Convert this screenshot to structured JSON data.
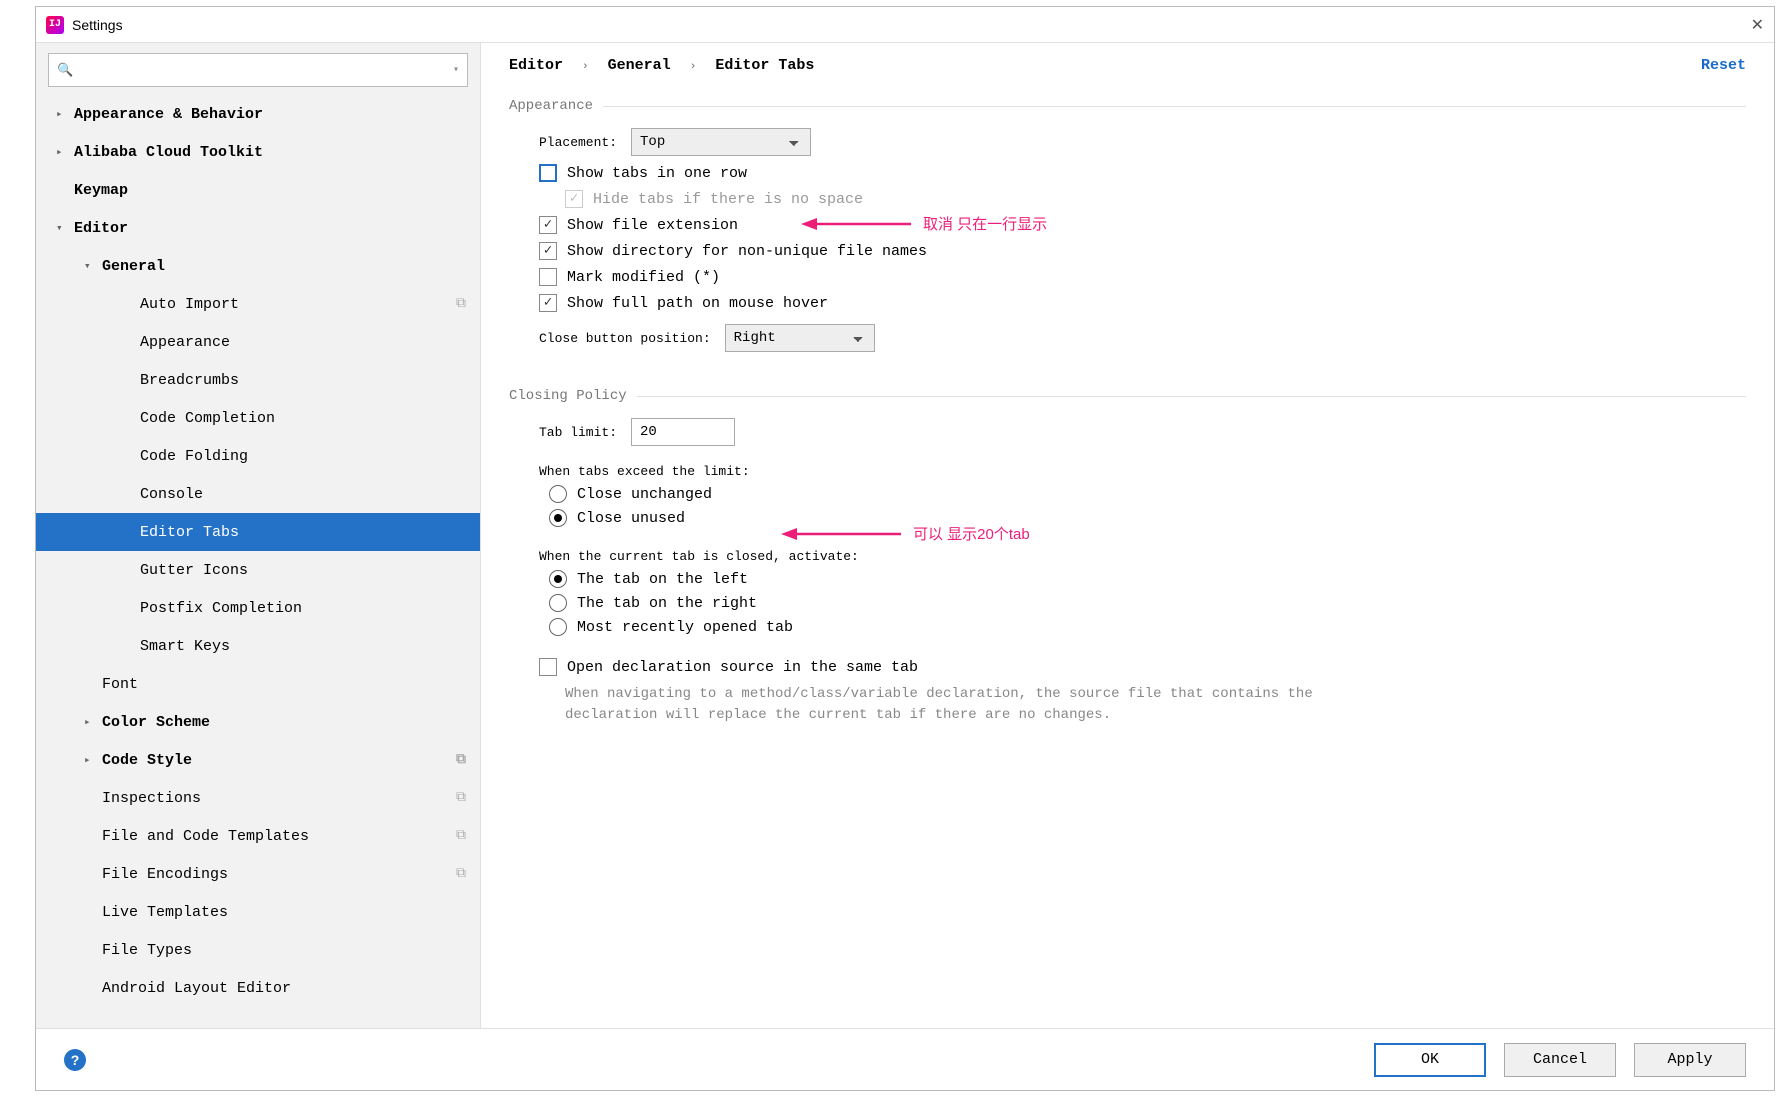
{
  "title": "Settings",
  "sidebar": {
    "search_placeholder": "",
    "items": [
      {
        "label": "Appearance & Behavior",
        "level": 0,
        "arrow": "right",
        "bold": true
      },
      {
        "label": "Alibaba Cloud Toolkit",
        "level": 0,
        "arrow": "right",
        "bold": true
      },
      {
        "label": "Keymap",
        "level": 0,
        "arrow": "none",
        "bold": true
      },
      {
        "label": "Editor",
        "level": 0,
        "arrow": "down",
        "bold": true
      },
      {
        "label": "General",
        "level": 1,
        "arrow": "down",
        "bold": true
      },
      {
        "label": "Auto Import",
        "level": 2,
        "arrow": "none",
        "copy": true
      },
      {
        "label": "Appearance",
        "level": 2,
        "arrow": "none"
      },
      {
        "label": "Breadcrumbs",
        "level": 2,
        "arrow": "none"
      },
      {
        "label": "Code Completion",
        "level": 2,
        "arrow": "none"
      },
      {
        "label": "Code Folding",
        "level": 2,
        "arrow": "none"
      },
      {
        "label": "Console",
        "level": 2,
        "arrow": "none"
      },
      {
        "label": "Editor Tabs",
        "level": 2,
        "arrow": "none",
        "selected": true
      },
      {
        "label": "Gutter Icons",
        "level": 2,
        "arrow": "none"
      },
      {
        "label": "Postfix Completion",
        "level": 2,
        "arrow": "none"
      },
      {
        "label": "Smart Keys",
        "level": 2,
        "arrow": "none"
      },
      {
        "label": "Font",
        "level": 1,
        "arrow": "none"
      },
      {
        "label": "Color Scheme",
        "level": 1,
        "arrow": "right",
        "bold": true
      },
      {
        "label": "Code Style",
        "level": 1,
        "arrow": "right",
        "bold": true,
        "copy": true
      },
      {
        "label": "Inspections",
        "level": 1,
        "arrow": "none",
        "copy": true
      },
      {
        "label": "File and Code Templates",
        "level": 1,
        "arrow": "none",
        "copy": true
      },
      {
        "label": "File Encodings",
        "level": 1,
        "arrow": "none",
        "copy": true
      },
      {
        "label": "Live Templates",
        "level": 1,
        "arrow": "none"
      },
      {
        "label": "File Types",
        "level": 1,
        "arrow": "none"
      },
      {
        "label": "Android Layout Editor",
        "level": 1,
        "arrow": "none"
      }
    ]
  },
  "breadcrumb": {
    "a": "Editor",
    "b": "General",
    "c": "Editor Tabs"
  },
  "reset_label": "Reset",
  "sections": {
    "appearance": "Appearance",
    "closing": "Closing Policy"
  },
  "form": {
    "placement_label": "Placement:",
    "placement_value": "Top",
    "show_one_row": "Show tabs in one row",
    "hide_no_space": "Hide tabs if there is no space",
    "show_ext": "Show file extension",
    "show_dir": "Show directory for non-unique file names",
    "mark_mod": "Mark modified (*)",
    "show_path": "Show full path on mouse hover",
    "close_pos_label": "Close button position:",
    "close_pos_value": "Right",
    "tab_limit_label": "Tab limit:",
    "tab_limit_value": "20",
    "exceed_label": "When tabs exceed the limit:",
    "exceed_opt1": "Close unchanged",
    "exceed_opt2": "Close unused",
    "activate_label": "When the current tab is closed, activate:",
    "activate_opt1": "The tab on the left",
    "activate_opt2": "The tab on the right",
    "activate_opt3": "Most recently opened tab",
    "open_decl": "Open declaration source in the same tab",
    "open_decl_hint": "When navigating to a method/class/variable declaration, the source file that contains the declaration will replace the current tab if there are no changes."
  },
  "annotations": {
    "a1": "取消 只在一行显示",
    "a2": "可以 显示20个tab"
  },
  "footer": {
    "ok": "OK",
    "cancel": "Cancel",
    "apply": "Apply"
  }
}
